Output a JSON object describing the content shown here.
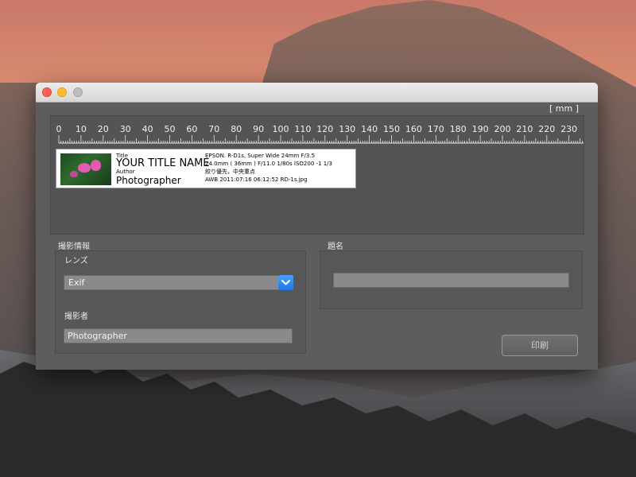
{
  "ruler": {
    "unit_label": "[ mm ]",
    "ticks": [
      "0",
      "10",
      "20",
      "30",
      "40",
      "50",
      "60",
      "70",
      "80",
      "90",
      "100",
      "110",
      "120",
      "130",
      "140",
      "150",
      "160",
      "170",
      "180",
      "190",
      "200",
      "210",
      "220",
      "230"
    ]
  },
  "label_card": {
    "title_caption": "Title",
    "title": "YOUR TITLE NAME",
    "author_caption": "Author",
    "author": "Photographer",
    "exif_lines": [
      "EPSON. R-D1s, Super Wide 24mm F/3.5",
      "24.0mm ( 36mm ) F/11.0 1/80s ISO200 -1 1/3",
      "絞り優先，中央重点",
      "AWB 2011:07:16 06:12:52 RD-1s.jpg"
    ]
  },
  "shooting_info": {
    "section_label": "撮影情報",
    "lens_label": "レンズ",
    "lens_value": "Exif",
    "photographer_label": "撮影者",
    "photographer_value": "Photographer"
  },
  "title_section": {
    "section_label": "題名",
    "title_value": ""
  },
  "actions": {
    "print_label": "印刷"
  },
  "colors": {
    "window_bg": "#5d5d5d",
    "accent_blue": "#1d76e6",
    "close": "#ff5f57",
    "minimize": "#ffbd2e",
    "maximize": "#bdbdbd"
  }
}
